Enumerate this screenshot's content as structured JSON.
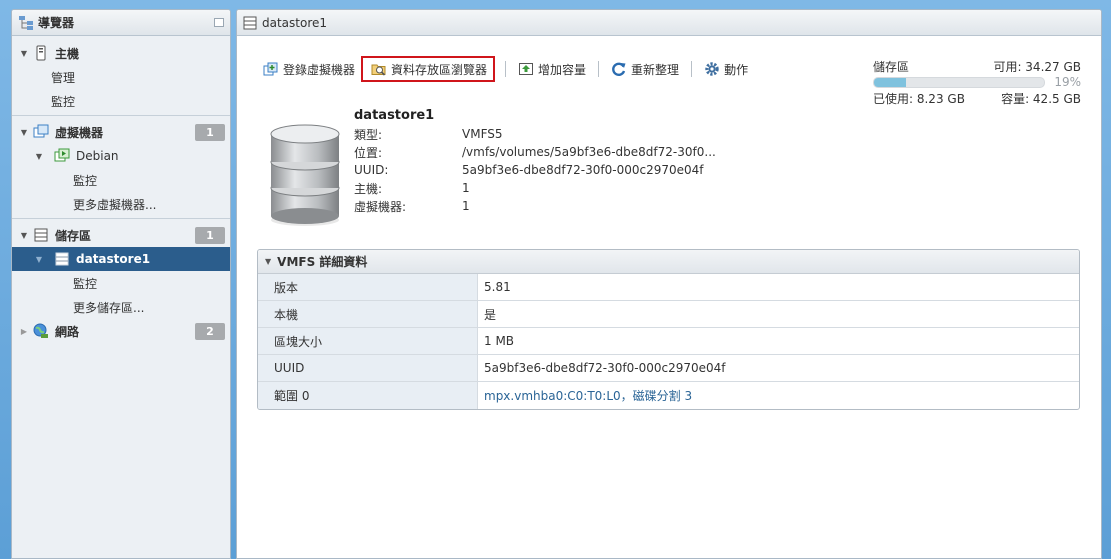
{
  "navigator": {
    "title": "導覽器",
    "items": [
      {
        "label": "主機"
      },
      {
        "label": "管理"
      },
      {
        "label": "監控"
      },
      {
        "label": "虛擬機器",
        "badge": "1"
      },
      {
        "label": "Debian"
      },
      {
        "label": "監控"
      },
      {
        "label": "更多虛擬機器..."
      },
      {
        "label": "儲存區",
        "badge": "1"
      },
      {
        "label": "datastore1"
      },
      {
        "label": "監控"
      },
      {
        "label": "更多儲存區..."
      },
      {
        "label": "網路",
        "badge": "2"
      }
    ]
  },
  "main": {
    "title": "datastore1",
    "toolbar": {
      "register_vm": "登錄虛擬機器",
      "datastore_browser": "資料存放區瀏覽器",
      "increase_capacity": "增加容量",
      "refresh": "重新整理",
      "actions": "動作"
    },
    "storage": {
      "label": "儲存區",
      "free": "可用: 34.27 GB",
      "percent": "19%",
      "percent_value": 19,
      "used": "已使用: 8.23 GB",
      "capacity": "容量: 42.5 GB"
    },
    "datastore": {
      "name": "datastore1",
      "fields": [
        {
          "k": "類型:",
          "v": "VMFS5"
        },
        {
          "k": "位置:",
          "v": "/vmfs/volumes/5a9bf3e6-dbe8df72-30f0..."
        },
        {
          "k": "UUID:",
          "v": "5a9bf3e6-dbe8df72-30f0-000c2970e04f"
        },
        {
          "k": "主機:",
          "v": "1"
        },
        {
          "k": "虛擬機器:",
          "v": "1"
        }
      ]
    },
    "vmfs": {
      "title": "VMFS 詳細資料",
      "rows": [
        {
          "k": "版本",
          "v": "5.81"
        },
        {
          "k": "本機",
          "v": "是"
        },
        {
          "k": "區塊大小",
          "v": "1 MB"
        },
        {
          "k": "UUID",
          "v": "5a9bf3e6-dbe8df72-30f0-000c2970e04f"
        },
        {
          "k": "範圍 0",
          "v": "mpx.vmhba0:C0:T0:L0，磁碟分割 3"
        }
      ]
    }
  },
  "colors": {
    "selected": "#2b5d8c",
    "highlight_border": "#d0151b",
    "bar_fill": "#7fc2de"
  }
}
